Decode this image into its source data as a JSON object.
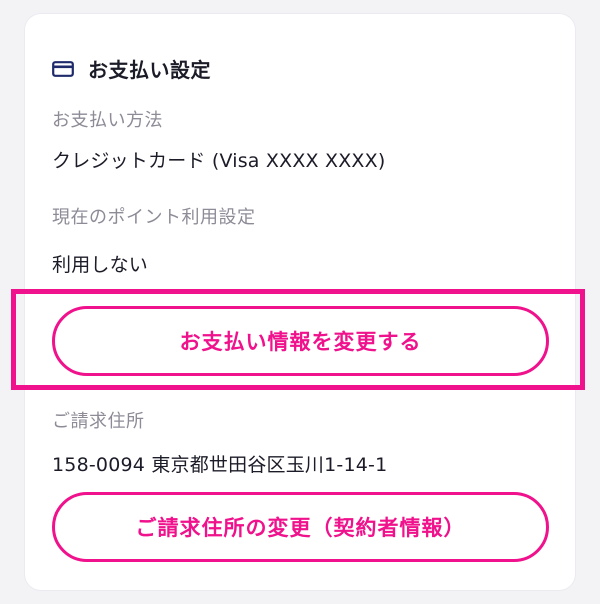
{
  "payment_settings": {
    "title": "お支払い設定",
    "method_label": "お支払い方法",
    "method_value": "クレジットカード (Visa XXXX XXXX)",
    "points_label": "現在のポイント利用設定",
    "points_value": "利用しない",
    "change_payment_button": "お支払い情報を変更する",
    "billing_address_label": "ご請求住所",
    "billing_address_value": "158-0094 東京都世田谷区玉川1-14-1",
    "change_address_button": "ご請求住所の変更（契約者情報）"
  },
  "colors": {
    "accent": "#f0118c",
    "title_icon": "#1f2a6b",
    "label": "#8e8b97",
    "text": "#1c1c28"
  },
  "icons": {
    "title_icon": "credit-card-icon"
  }
}
